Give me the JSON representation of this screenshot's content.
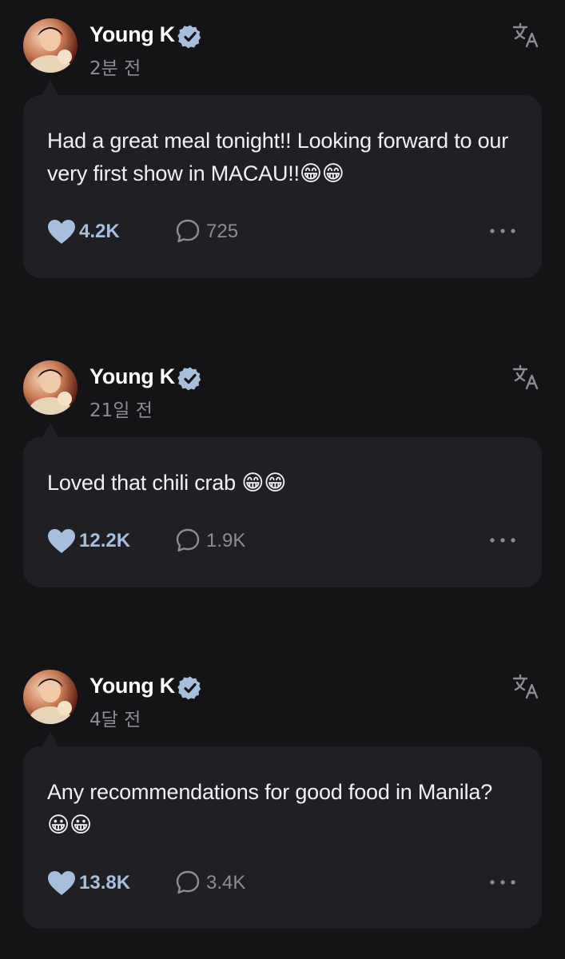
{
  "posts": [
    {
      "author": "Young K",
      "verified": true,
      "timestamp": "2분 전",
      "text": "Had a great meal tonight!! Looking forward to our very first show in MACAU!!😁😁",
      "likes": "4.2K",
      "comments": "725",
      "icons": [
        "verified-badge-icon",
        "translate-icon",
        "heart-icon",
        "comment-icon",
        "more-icon"
      ]
    },
    {
      "author": "Young K",
      "verified": true,
      "timestamp": "21일 전",
      "text": "Loved that chili crab 😁😁",
      "likes": "12.2K",
      "comments": "1.9K",
      "icons": [
        "verified-badge-icon",
        "translate-icon",
        "heart-icon",
        "comment-icon",
        "more-icon"
      ]
    },
    {
      "author": "Young K",
      "verified": true,
      "timestamp": "4달 전",
      "text": "Any recommendations for good food in Manila? 😀😀",
      "likes": "13.8K",
      "comments": "3.4K",
      "icons": [
        "verified-badge-icon",
        "translate-icon",
        "heart-icon",
        "comment-icon",
        "more-icon"
      ]
    }
  ],
  "colors": {
    "background": "#141417",
    "card": "#202024",
    "like_accent": "#a7bfdc",
    "verified_badge": "#a7bfdc",
    "muted_text": "#8c8c93"
  }
}
